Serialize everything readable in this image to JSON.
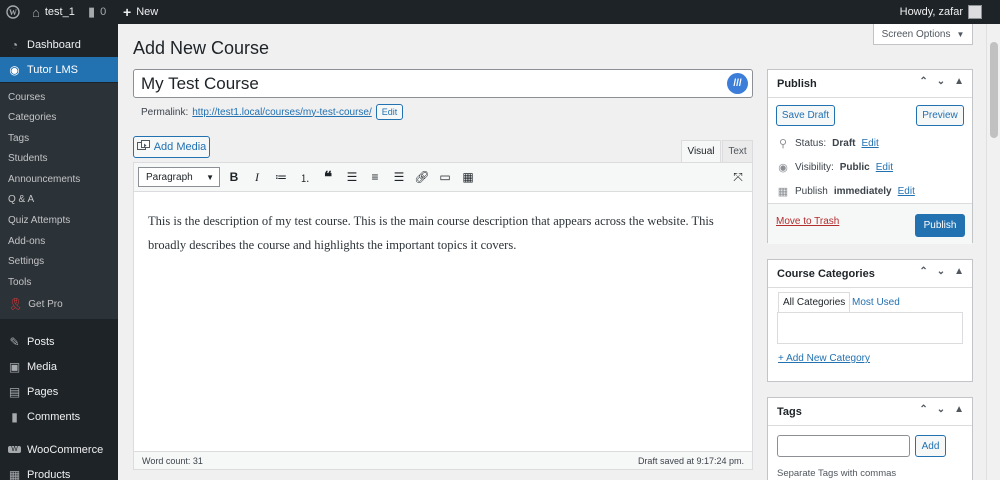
{
  "adminbar": {
    "site_name": "test_1",
    "comments_count": "0",
    "new_label": "New",
    "greeting": "Howdy, zafar"
  },
  "sidebar": {
    "items": [
      {
        "label": "Dashboard",
        "icon": "dashboard-icon"
      },
      {
        "label": "Tutor LMS",
        "icon": "tutor-lms-icon",
        "active": true
      },
      {
        "label": "Posts",
        "icon": "pin-icon"
      },
      {
        "label": "Media",
        "icon": "media-icon"
      },
      {
        "label": "Pages",
        "icon": "page-icon"
      },
      {
        "label": "Comments",
        "icon": "comment-icon"
      },
      {
        "label": "WooCommerce",
        "icon": "woocommerce-icon"
      },
      {
        "label": "Products",
        "icon": "products-icon"
      }
    ],
    "submenu": [
      "Courses",
      "Categories",
      "Tags",
      "Students",
      "Announcements",
      "Q & A",
      "Quiz Attempts",
      "Add-ons",
      "Settings",
      "Tools",
      "Get Pro"
    ]
  },
  "header": {
    "title": "Add New Course",
    "screen_options": "Screen Options"
  },
  "editor": {
    "post_title": "My Test Course",
    "permalink_label": "Permalink:",
    "permalink_url": "http://test1.local/courses/my-test-course/",
    "edit_label": "Edit",
    "add_media": "Add Media",
    "tab_visual": "Visual",
    "tab_text": "Text",
    "format": "Paragraph",
    "body": "This is the description of my test course. This is the main course description that appears across the website. This broadly describes the course and highlights the important topics it covers.",
    "word_count": "Word count: 31",
    "draft_saved": "Draft saved at 9:17:24 pm."
  },
  "publish": {
    "title": "Publish",
    "save_draft": "Save Draft",
    "preview": "Preview",
    "status_label": "Status:",
    "status_value": "Draft",
    "visibility_label": "Visibility:",
    "visibility_value": "Public",
    "publish_label": "Publish",
    "publish_value": "immediately",
    "edit": "Edit",
    "trash": "Move to Trash",
    "publish_button": "Publish"
  },
  "categories": {
    "title": "Course Categories",
    "tab_all": "All Categories",
    "tab_most_used": "Most Used",
    "add_new": "+ Add New Category"
  },
  "tags": {
    "title": "Tags",
    "add": "Add",
    "hint": "Separate Tags with commas"
  },
  "colors": {
    "accent": "#2271b1",
    "sidebar_bg": "#1d2327",
    "trash": "#b32d2e"
  }
}
